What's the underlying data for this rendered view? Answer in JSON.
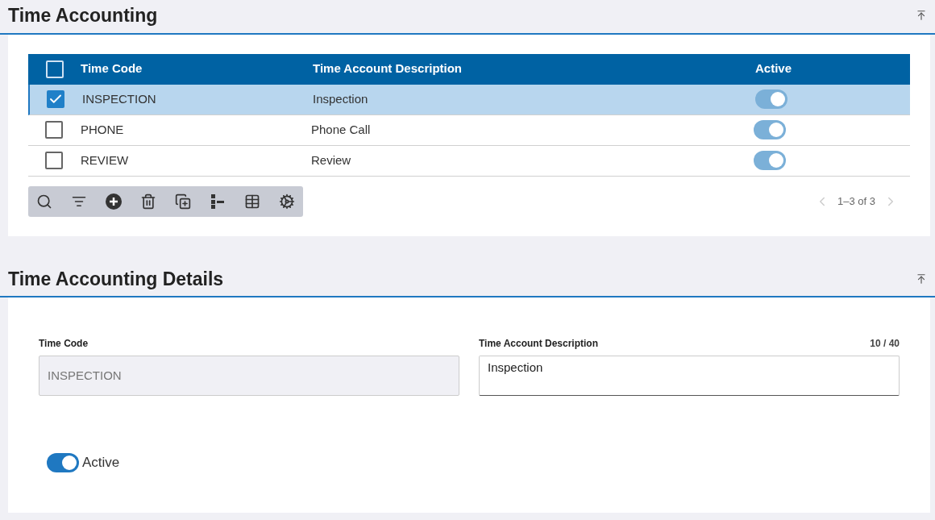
{
  "list_section": {
    "title": "Time Accounting",
    "table": {
      "select_all": {
        "checked": false
      },
      "columns": [
        "Time Code",
        "Time Account Description",
        "Active"
      ],
      "rows": [
        {
          "code": "INSPECTION",
          "description": "Inspection",
          "active": true,
          "selected": true,
          "checked": true
        },
        {
          "code": "PHONE",
          "description": "Phone Call",
          "active": true,
          "selected": false,
          "checked": false
        },
        {
          "code": "REVIEW",
          "description": "Review",
          "active": true,
          "selected": false,
          "checked": false
        }
      ]
    },
    "pagination": "1–3 of 3"
  },
  "details_section": {
    "title": "Time Accounting Details",
    "time_code": {
      "label": "Time Code",
      "value": "INSPECTION",
      "disabled": true
    },
    "description": {
      "label": "Time Account Description",
      "value": "Inspection",
      "counter": "10 / 40"
    },
    "active": {
      "label": "Active",
      "on": true
    }
  }
}
